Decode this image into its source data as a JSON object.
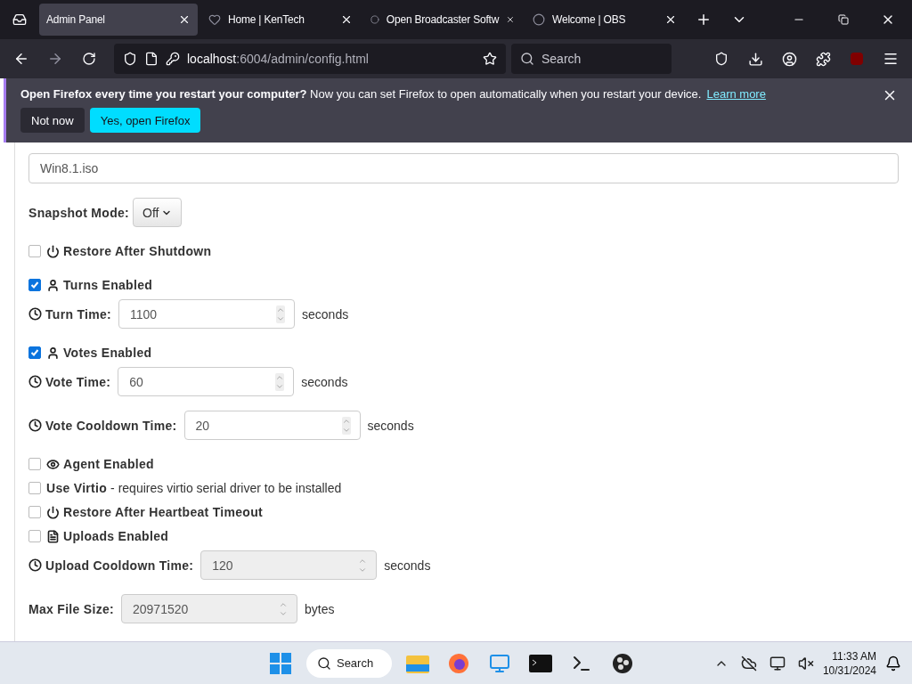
{
  "browser": {
    "tabs": [
      {
        "title": "Admin Panel",
        "selected": true
      },
      {
        "title": "Home | KenTech",
        "selected": false
      },
      {
        "title": "Open Broadcaster Softw",
        "selected": false
      },
      {
        "title": "Welcome | OBS",
        "selected": false
      }
    ],
    "address": {
      "host": "localhost",
      "path": ":6004/admin/config.html"
    },
    "search": {
      "placeholder": "Search"
    }
  },
  "notification": {
    "message": "**Open Firefox every time you restart your computer?** Now you can set Firefox to open automatically when you restart your device.",
    "link": "Learn more",
    "buttons": [
      {
        "label": "Not now",
        "kind": "secondary"
      },
      {
        "label": "Yes, open Firefox",
        "kind": "primary"
      }
    ]
  },
  "form": {
    "sections": [
      [
        {
          "kind": "text",
          "value": "Win8.1.iso"
        }
      ],
      [
        {
          "kind": "dropdown",
          "label": "Snapshot Mode:",
          "value": "Off"
        }
      ],
      [
        {
          "kind": "checkbox",
          "label": "Restore After Shutdown",
          "checked": false
        }
      ],
      [
        {
          "kind": "checkbox",
          "label": "Turns Enabled",
          "checked": true
        },
        {
          "kind": "number",
          "label": "Turn Time:",
          "value": "1100",
          "unit": "seconds",
          "disabled": false
        }
      ],
      [
        {
          "kind": "checkbox",
          "label": "Votes Enabled",
          "checked": true
        },
        {
          "kind": "number",
          "label": "Vote Time:",
          "value": "60",
          "unit": "seconds",
          "disabled": false
        }
      ],
      [
        {
          "kind": "number",
          "label": "Vote Cooldown Time:",
          "value": "20",
          "unit": "seconds",
          "disabled": false
        }
      ],
      [
        {
          "kind": "checkbox",
          "label": "Agent Enabled",
          "checked": false
        },
        {
          "kind": "checkbox",
          "label": "Use Virtio",
          "note": "- requires virtio serial driver to be installed",
          "checked": false
        },
        {
          "kind": "checkbox",
          "label": "Restore After Heartbeat Timeout",
          "checked": false
        },
        {
          "kind": "checkbox",
          "label": "Uploads Enabled",
          "checked": false
        },
        {
          "kind": "number",
          "label": "Upload Cooldown Time:",
          "value": "120",
          "unit": "seconds",
          "disabled": true
        }
      ],
      [
        {
          "kind": "number",
          "label": "Max File Size:",
          "value": "20971520",
          "unit": "bytes",
          "disabled": true
        }
      ]
    ]
  },
  "taskbar": {
    "search": "Search",
    "time": "11:33 AM",
    "date": "10/31/2024"
  }
}
